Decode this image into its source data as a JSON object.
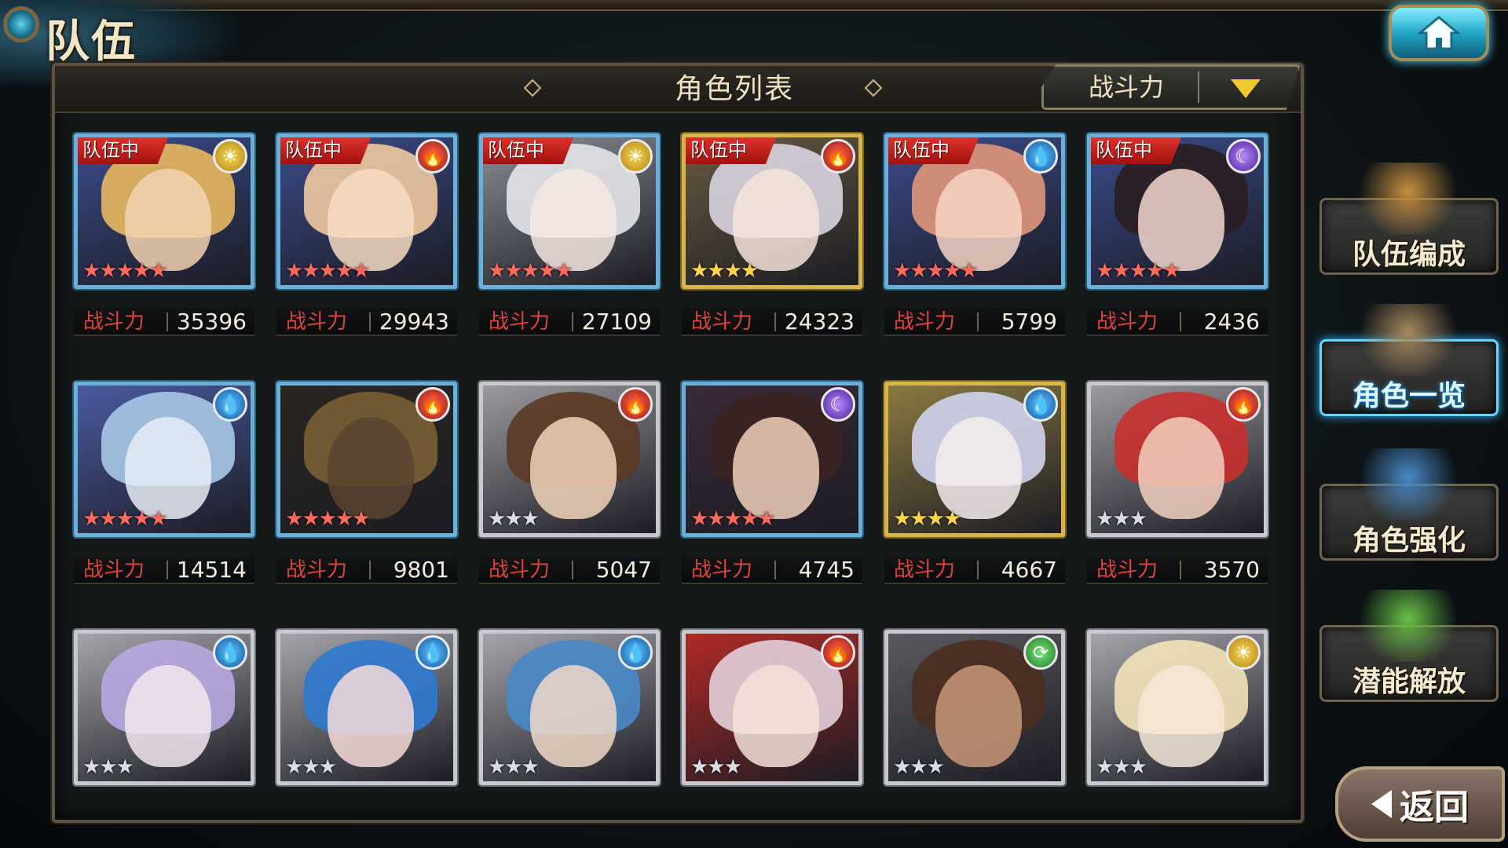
{
  "page": {
    "title": "队伍"
  },
  "header": {
    "panel_title": "角色列表",
    "sort": {
      "selected": "战斗力"
    }
  },
  "power_label": "战斗力",
  "team_badge_label": "队伍中",
  "characters": [
    {
      "element": "light",
      "element_glyph": "☀",
      "in_team": true,
      "stars": 5,
      "star_color": "red",
      "frame": "rare",
      "power": "35396",
      "hair": "#e8b860",
      "face": "#f2d2b0",
      "bg": "#3a4b8a"
    },
    {
      "element": "fire",
      "element_glyph": "🔥",
      "in_team": true,
      "stars": 5,
      "star_color": "red",
      "frame": "rare",
      "power": "29943",
      "hair": "#f0c8a0",
      "face": "#f6dcc4",
      "bg": "#3a4b8a"
    },
    {
      "element": "light",
      "element_glyph": "☀",
      "in_team": true,
      "stars": 5,
      "star_color": "red",
      "frame": "rare",
      "power": "27109",
      "hair": "#e4e6ea",
      "face": "#f4e8e0",
      "bg": "#8a8e96"
    },
    {
      "element": "fire",
      "element_glyph": "🔥",
      "in_team": true,
      "stars": 4,
      "star_color": "gold",
      "frame": "gold",
      "power": "24323",
      "hair": "#d8d4e0",
      "face": "#f6e4dc",
      "bg": "#6a5a40"
    },
    {
      "element": "water",
      "element_glyph": "💧",
      "in_team": true,
      "stars": 5,
      "star_color": "red",
      "frame": "rare",
      "power": "5799",
      "hair": "#e0967a",
      "face": "#f6d4c4",
      "bg": "#3a4b8a"
    },
    {
      "element": "dark",
      "element_glyph": "☾",
      "in_team": true,
      "stars": 5,
      "star_color": "red",
      "frame": "rare",
      "power": "2436",
      "hair": "#2a1e24",
      "face": "#f2d8cc",
      "bg": "#3a4b8a"
    },
    {
      "element": "water",
      "element_glyph": "💧",
      "in_team": false,
      "stars": 5,
      "star_color": "red",
      "frame": "rare",
      "power": "14514",
      "hair": "#a8c8e8",
      "face": "#e8ecf6",
      "bg": "#4a5aa0"
    },
    {
      "element": "fire",
      "element_glyph": "🔥",
      "in_team": false,
      "stars": 5,
      "star_color": "red",
      "frame": "rare",
      "power": "9801",
      "hair": "#7a6034",
      "face": "#5a4430",
      "bg": "#2a2620"
    },
    {
      "element": "fire",
      "element_glyph": "🔥",
      "in_team": false,
      "stars": 3,
      "star_color": "silver",
      "frame": "silver",
      "power": "5047",
      "hair": "#5a3a24",
      "face": "#f0d4b8",
      "bg": "#9a9aa0"
    },
    {
      "element": "dark",
      "element_glyph": "☾",
      "in_team": false,
      "stars": 5,
      "star_color": "red",
      "frame": "rare",
      "power": "4745",
      "hair": "#3a2220",
      "face": "#f0d0bc",
      "bg": "#3a2a3a"
    },
    {
      "element": "water",
      "element_glyph": "💧",
      "in_team": false,
      "stars": 4,
      "star_color": "gold",
      "frame": "gold",
      "power": "4667",
      "hair": "#d0d4ee",
      "face": "#f4ecee",
      "bg": "#8a7a40"
    },
    {
      "element": "fire",
      "element_glyph": "🔥",
      "in_team": false,
      "stars": 3,
      "star_color": "silver",
      "frame": "silver",
      "power": "3570",
      "hair": "#c8302c",
      "face": "#f2d0c0",
      "bg": "#9a9aa0"
    },
    {
      "element": "water",
      "element_glyph": "💧",
      "in_team": false,
      "stars": 3,
      "star_color": "silver",
      "frame": "silver",
      "power": "",
      "hair": "#b8a8e0",
      "face": "#f4e8ee",
      "bg": "#a4a4aa"
    },
    {
      "element": "water",
      "element_glyph": "💧",
      "in_team": false,
      "stars": 3,
      "star_color": "silver",
      "frame": "silver",
      "power": "",
      "hair": "#2e7ad0",
      "face": "#f6dcd8",
      "bg": "#a4a4aa"
    },
    {
      "element": "water",
      "element_glyph": "💧",
      "in_team": false,
      "stars": 3,
      "star_color": "silver",
      "frame": "silver",
      "power": "",
      "hair": "#4a88c8",
      "face": "#f0d8c8",
      "bg": "#a4a4aa"
    },
    {
      "element": "fire",
      "element_glyph": "🔥",
      "in_team": false,
      "stars": 3,
      "star_color": "silver",
      "frame": "silver",
      "power": "",
      "hair": "#e2d0dc",
      "face": "#f4e2d8",
      "bg": "#b02a26"
    },
    {
      "element": "wind",
      "element_glyph": "⟳",
      "in_team": false,
      "stars": 3,
      "star_color": "silver",
      "frame": "silver",
      "power": "",
      "hair": "#4a2e20",
      "face": "#c89878",
      "bg": "#5a5a5e"
    },
    {
      "element": "light",
      "element_glyph": "☀",
      "in_team": false,
      "stars": 3,
      "star_color": "silver",
      "frame": "silver",
      "power": "",
      "hair": "#f2e2b8",
      "face": "#f6e8d8",
      "bg": "#a4a4aa"
    }
  ],
  "side_menu": [
    {
      "label": "队伍编成",
      "active": false,
      "art": "#c89040"
    },
    {
      "label": "角色一览",
      "active": true,
      "art": "#a88a60"
    },
    {
      "label": "角色强化",
      "active": false,
      "art": "#4a8ac8"
    },
    {
      "label": "潜能解放",
      "active": false,
      "art": "#6ac048"
    }
  ],
  "back_button": {
    "label": "返回"
  }
}
